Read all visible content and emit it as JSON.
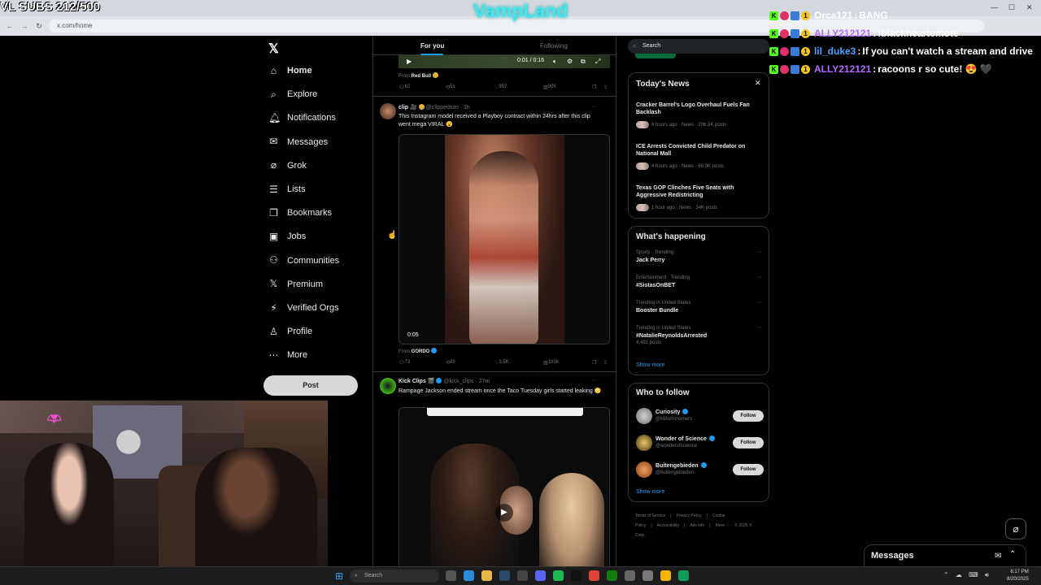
{
  "overlay": {
    "subs": "VL SUBS 212/500",
    "brand": "VampLand"
  },
  "browser": {
    "url": "x.com/home"
  },
  "nav": {
    "items": [
      {
        "label": "Home",
        "icon": "home-icon",
        "glyph": "⌂",
        "active": true
      },
      {
        "label": "Explore",
        "icon": "search-icon",
        "glyph": "⌕"
      },
      {
        "label": "Notifications",
        "icon": "bell-icon",
        "glyph": "🔔︎"
      },
      {
        "label": "Messages",
        "icon": "mail-icon",
        "glyph": "✉"
      },
      {
        "label": "Grok",
        "icon": "grok-icon",
        "glyph": "⌀"
      },
      {
        "label": "Lists",
        "icon": "list-icon",
        "glyph": "☰"
      },
      {
        "label": "Bookmarks",
        "icon": "bookmark-icon",
        "glyph": "❐"
      },
      {
        "label": "Jobs",
        "icon": "briefcase-icon",
        "glyph": "▣"
      },
      {
        "label": "Communities",
        "icon": "people-icon",
        "glyph": "⚇"
      },
      {
        "label": "Premium",
        "icon": "x-logo-icon",
        "glyph": "𝕏"
      },
      {
        "label": "Verified Orgs",
        "icon": "lightning-icon",
        "glyph": "⚡︎"
      },
      {
        "label": "Profile",
        "icon": "person-icon",
        "glyph": "♙"
      },
      {
        "label": "More",
        "icon": "more-circle-icon",
        "glyph": "⋯"
      }
    ],
    "post_label": "Post"
  },
  "feed": {
    "tabs": [
      "For you",
      "Following"
    ],
    "video_top": {
      "time": "0:01 / 0:16",
      "from_label": "From",
      "from": "Red Bull"
    },
    "actions_top": {
      "replies": "62",
      "reposts": "51",
      "likes": "957",
      "views": "90K"
    },
    "tweet1": {
      "name": "clip",
      "handle": "@clippedszn",
      "time": "· 1h",
      "text": "This Instagram model received a Playboy contract within 24hrs after this clip went mega VIRAL 😮",
      "duration": "0:05",
      "from_label": "From",
      "from": "GORDO",
      "replies": "73",
      "reposts": "89",
      "likes": "3.5K",
      "views": "183K"
    },
    "tweet2": {
      "name": "Kick Clips",
      "handle": "@kick_clips",
      "time": "· 27m",
      "text": "Rampage Jackson ended stream once the Taco Tuesday girls started leaking 😳"
    }
  },
  "right": {
    "search_placeholder": "Search",
    "news": {
      "title": "Today's News",
      "items": [
        {
          "title": "Cracker Barrel's Logo Overhaul Fuels Fan Backlash",
          "meta": "6 hours ago · News · 206.5K posts"
        },
        {
          "title": "ICE Arrests Convicted Child Predator on National Mall",
          "meta": "4 hours ago · News · 68.9K posts"
        },
        {
          "title": "Texas GOP Clinches Five Seats with Aggressive Redistricting",
          "meta": "1 hour ago · News · 34K posts"
        }
      ]
    },
    "happening": {
      "title": "What's happening",
      "items": [
        {
          "category": "Sports · Trending",
          "name": "Jack Perry",
          "posts": ""
        },
        {
          "category": "Entertainment · Trending",
          "name": "#SistasOnBET",
          "posts": ""
        },
        {
          "category": "Trending in United States",
          "name": "Booster Bundle",
          "posts": ""
        },
        {
          "category": "Trending in United States",
          "name": "#NatalieReynoldsArrested",
          "posts": "4,491 posts"
        }
      ],
      "show_more": "Show more"
    },
    "who_to_follow": {
      "title": "Who to follow",
      "items": [
        {
          "name": "Curiosity",
          "handle": "@MAstronomers",
          "button": "Follow"
        },
        {
          "name": "Wonder of Science",
          "handle": "@wonderofscience",
          "button": "Follow"
        },
        {
          "name": "Buitengebieden",
          "handle": "@buitengebieden",
          "button": "Follow"
        }
      ],
      "show_more": "Show more"
    },
    "footer": [
      "Terms of Service",
      "|",
      "Privacy Policy",
      "|",
      "Cookie Policy",
      "|",
      "Accessibility",
      "|",
      "Ads info",
      "|",
      "More ···",
      "© 2025 X Corp."
    ]
  },
  "chat": [
    {
      "user": "Orca121",
      "user_color": "#ffffff",
      "msg": "BANG"
    },
    {
      "user": "ALLY212121",
      "user_color": "#b36bff",
      "msg": "!blackheartemote"
    },
    {
      "user": "lil_duke3",
      "user_color": "#4aa3ff",
      "msg": "If you can't watch a stream and drive"
    },
    {
      "user": "ALLY212121",
      "user_color": "#b36bff",
      "msg": "racoons r so cute! 😍 🖤"
    }
  ],
  "messages_drawer": {
    "label": "Messages"
  },
  "taskbar": {
    "search": "Search",
    "time": "6:17 PM",
    "date": "8/20/2025"
  }
}
